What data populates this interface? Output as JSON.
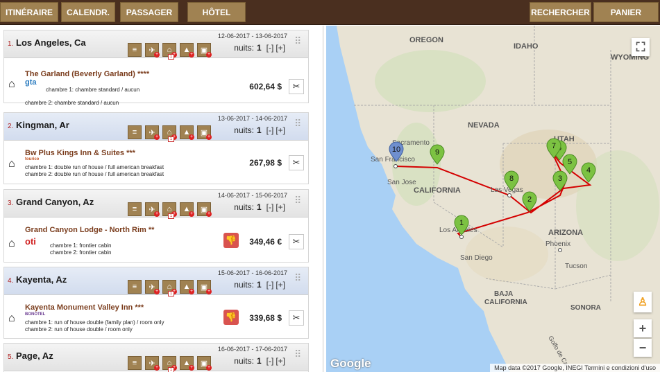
{
  "nav": {
    "itinerary": "ITINÉRAIRE",
    "calendar": "CALENDR.",
    "passenger": "PASSAGER",
    "hotel": "HÔTEL",
    "search": "RECHERCHER",
    "cart": "PANIER"
  },
  "days": [
    {
      "num": "1.",
      "city": "Los Angeles, Ca",
      "dates": "12-06-2017 - 13-06-2017",
      "nights_label": "nuits:",
      "nights": "1",
      "minus": "[-]",
      "plus": "[+]",
      "hotel": "The Garland (Beverly Garland) ****",
      "supplier": "gta",
      "rooms": [
        "chambre 1: chambre standard / aucun",
        "chambre 2: chambre standard / aucun"
      ],
      "price": "602,64 $",
      "thumb": false
    },
    {
      "num": "2.",
      "city": "Kingman, Ar",
      "dates": "13-06-2017 - 14-06-2017",
      "nights_label": "nuits:",
      "nights": "1",
      "minus": "[-]",
      "plus": "[+]",
      "hotel": "Bw Plus Kings Inn & Suites ***",
      "supplier": "tourico",
      "rooms": [
        "chambre 1: double run of house / full american breakfast",
        "chambre 2: double run of house / full american breakfast"
      ],
      "price": "267,98 $",
      "thumb": false
    },
    {
      "num": "3.",
      "city": "Grand Canyon, Az",
      "dates": "14-06-2017 - 15-06-2017",
      "nights_label": "nuits:",
      "nights": "1",
      "minus": "[-]",
      "plus": "[+]",
      "hotel": "Grand Canyon Lodge - North Rim **",
      "supplier": "oti",
      "rooms": [
        "chambre 1: frontier cabin",
        "chambre 2: frontier cabin"
      ],
      "price": "349,46 €",
      "thumb": true
    },
    {
      "num": "4.",
      "city": "Kayenta, Az",
      "dates": "15-06-2017 - 16-06-2017",
      "nights_label": "nuits:",
      "nights": "1",
      "minus": "[-]",
      "plus": "[+]",
      "hotel": "Kayenta Monument Valley Inn ***",
      "supplier": "BONOTEL",
      "rooms": [
        "chambre 1: run of house double (family plan) / room only",
        "chambre 2: run of house double / room only"
      ],
      "price": "339,68 $",
      "thumb": true
    },
    {
      "num": "5.",
      "city": "Page, Az",
      "dates": "16-06-2017 - 17-06-2017",
      "nights_label": "nuits:",
      "nights": "1",
      "minus": "[-]",
      "plus": "[+]"
    }
  ],
  "map": {
    "labels": {
      "oregon": "OREGON",
      "idaho": "IDAHO",
      "wyoming": "WYOMING",
      "nevada": "NEVADA",
      "utah": "UTAH",
      "california": "CALIFORNIA",
      "arizona": "ARIZONA",
      "sacramento": "Sacramento",
      "san_francisco": "San Francisco",
      "san_jose": "San Jose",
      "las_vegas": "Las Vegas",
      "los_angeles": "Los Angeles",
      "phoenix": "Phoenix",
      "san_diego": "San Diego",
      "tucson": "Tucson",
      "baja": "BAJA",
      "baja2": "CALIFORNIA",
      "sonora": "SONORA",
      "gulf": "Golfo de Ca"
    },
    "pins": [
      "1",
      "2",
      "3",
      "4",
      "5",
      "6",
      "7",
      "8",
      "9",
      "10"
    ],
    "google": "Google",
    "attribution": "Map data ©2017 Google, INEGI    Termini e condizioni d'uso",
    "zoom_in": "+",
    "zoom_out": "−",
    "route_color": "#d40000",
    "pin_color": "#7cc242"
  }
}
